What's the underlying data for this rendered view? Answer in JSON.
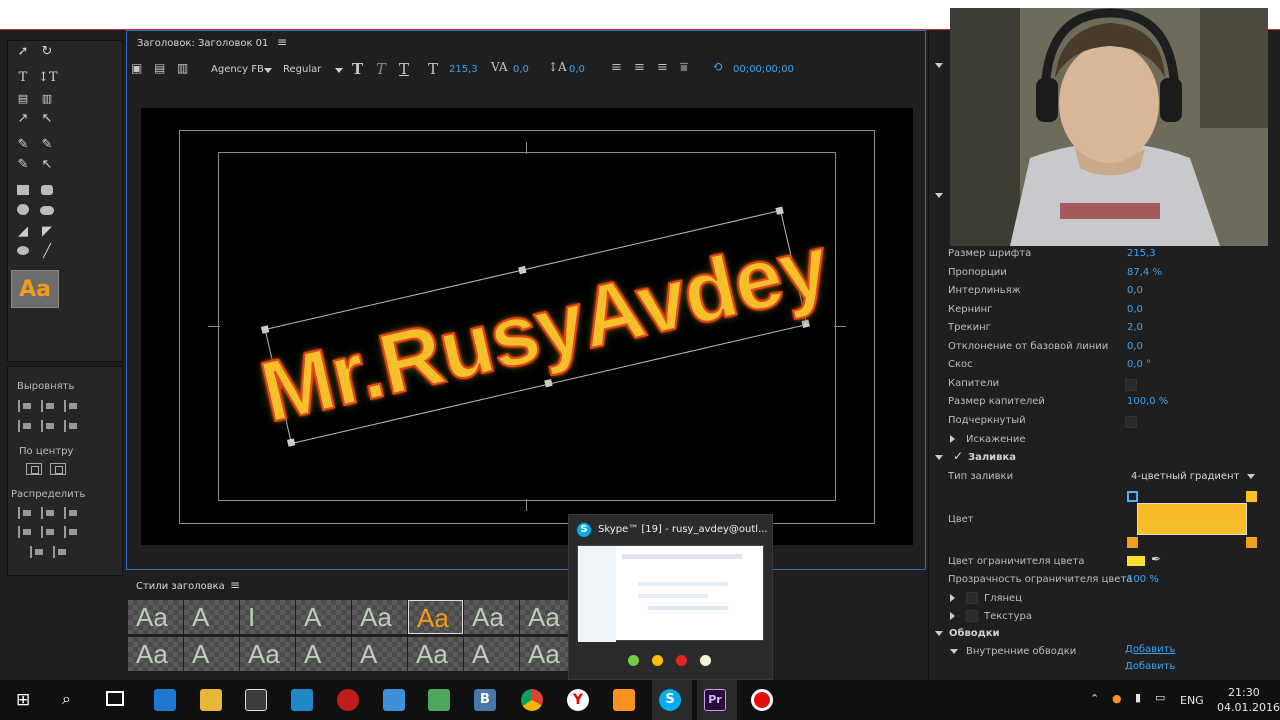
{
  "panel_title": "Заголовок: Заголовок 01",
  "toolbar": {
    "font": "Agency FB",
    "style": "Regular",
    "size": "215,3",
    "kerning": "0,0",
    "leading": "0,0",
    "timecode": "00;00;00;00"
  },
  "canvas": {
    "title_text": "Mr.RusyAvdey",
    "fill_color": "#f6c02a",
    "stroke_color": "#e1481a"
  },
  "tools_panel": {
    "style_sample": "Aa"
  },
  "align_panel": {
    "align_label": "Выровнять",
    "center_label": "По центру",
    "distribute_label": "Распределить"
  },
  "styles_panel": {
    "title": "Стили заголовка",
    "swatch_labels": [
      "Aa",
      "A",
      "I",
      "A",
      "Aa",
      "Aa",
      "Aa",
      "Aa",
      "Aa",
      "A",
      "Aa",
      "A",
      "A",
      "Aa",
      "A",
      "Aa"
    ]
  },
  "properties": {
    "rows": [
      {
        "label": "Размер шрифта",
        "value": "215,3"
      },
      {
        "label": "Пропорции",
        "value": "87,4 %"
      },
      {
        "label": "Интерлиньяж",
        "value": "0,0"
      },
      {
        "label": "Кернинг",
        "value": "0,0"
      },
      {
        "label": "Трекинг",
        "value": "2,0"
      },
      {
        "label": "Отклонение от базовой линии",
        "value": "0,0"
      },
      {
        "label": "Скос",
        "value": "0,0 °"
      },
      {
        "label": "Капители",
        "value": ""
      },
      {
        "label": "Размер капителей",
        "value": "100,0 %"
      },
      {
        "label": "Подчеркнутый",
        "value": ""
      }
    ],
    "distortion": "Искажение",
    "fill_section": "Заливка",
    "fill_type_label": "Тип заливки",
    "fill_type_value": "4-цветный градиент",
    "color_label": "Цвет",
    "stop_color_label": "Цвет ограничителя цвета",
    "stop_opacity_label": "Прозрачность ограничителя цвета",
    "stop_opacity_value": "100 %",
    "gloss": "Глянец",
    "texture": "Текстура",
    "strokes_section": "Обводки",
    "inner_strokes": "Внутренние обводки",
    "add_link": "Добавить",
    "add_link_2": "Добавить",
    "gradient_color": "#f7b926"
  },
  "skype": {
    "title": "Skype™ [19] - rusy_avdey@outl..."
  },
  "taskbar": {
    "lang": "ENG",
    "time": "21:30",
    "date": "04.01.2016"
  }
}
